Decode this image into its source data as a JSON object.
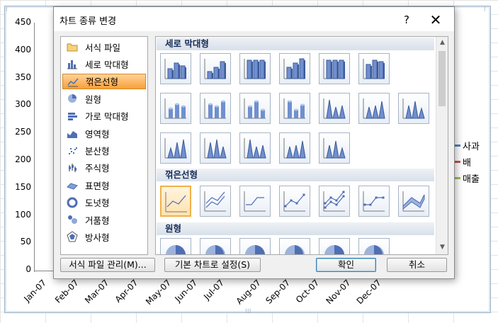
{
  "chart": {
    "y_ticks": [
      "450",
      "400",
      "350",
      "300",
      "250",
      "200",
      "150",
      "100",
      "50",
      "0"
    ],
    "x_ticks": [
      "Jan-07",
      "Feb-07",
      "Mar-07",
      "Apr-07",
      "May-07",
      "Jun-07",
      "Jul-07",
      "Aug-07",
      "Sep-07",
      "Oct-07",
      "Nov-07",
      "Dec-07"
    ],
    "legend": [
      {
        "label": "사과",
        "color": "#4f81bd"
      },
      {
        "label": "배",
        "color": "#c0504d"
      },
      {
        "label": "매출",
        "color": "#9bbb59"
      }
    ]
  },
  "dialog": {
    "title": "차트 종류 변경",
    "help_glyph": "?",
    "close_glyph": "✕",
    "chart_types": [
      {
        "label": "서식 파일",
        "icon": "folder-icon",
        "selected": false
      },
      {
        "label": "세로 막대형",
        "icon": "column-chart-icon",
        "selected": false
      },
      {
        "label": "꺾은선형",
        "icon": "line-chart-icon",
        "selected": true
      },
      {
        "label": "원형",
        "icon": "pie-chart-icon",
        "selected": false
      },
      {
        "label": "가로 막대형",
        "icon": "bar-chart-icon",
        "selected": false
      },
      {
        "label": "영역형",
        "icon": "area-chart-icon",
        "selected": false
      },
      {
        "label": "분산형",
        "icon": "scatter-chart-icon",
        "selected": false
      },
      {
        "label": "주식형",
        "icon": "stock-chart-icon",
        "selected": false
      },
      {
        "label": "표면형",
        "icon": "surface-chart-icon",
        "selected": false
      },
      {
        "label": "도넛형",
        "icon": "doughnut-chart-icon",
        "selected": false
      },
      {
        "label": "거품형",
        "icon": "bubble-chart-icon",
        "selected": false
      },
      {
        "label": "방사형",
        "icon": "radar-chart-icon",
        "selected": false
      }
    ],
    "sections": [
      {
        "header": "세로 막대형"
      },
      {
        "header": "꺾은선형"
      },
      {
        "header": "원형"
      }
    ],
    "buttons": {
      "manage_templates": "서식 파일 관리(M)...",
      "set_default": "기본 차트로 설정(S)",
      "ok": "확인",
      "cancel": "취소"
    },
    "scroll_up_glyph": "▲",
    "scroll_down_glyph": "▼"
  },
  "colors": {
    "selection_orange": "#f89f3a",
    "chart_blue": "#4f6fb5"
  }
}
